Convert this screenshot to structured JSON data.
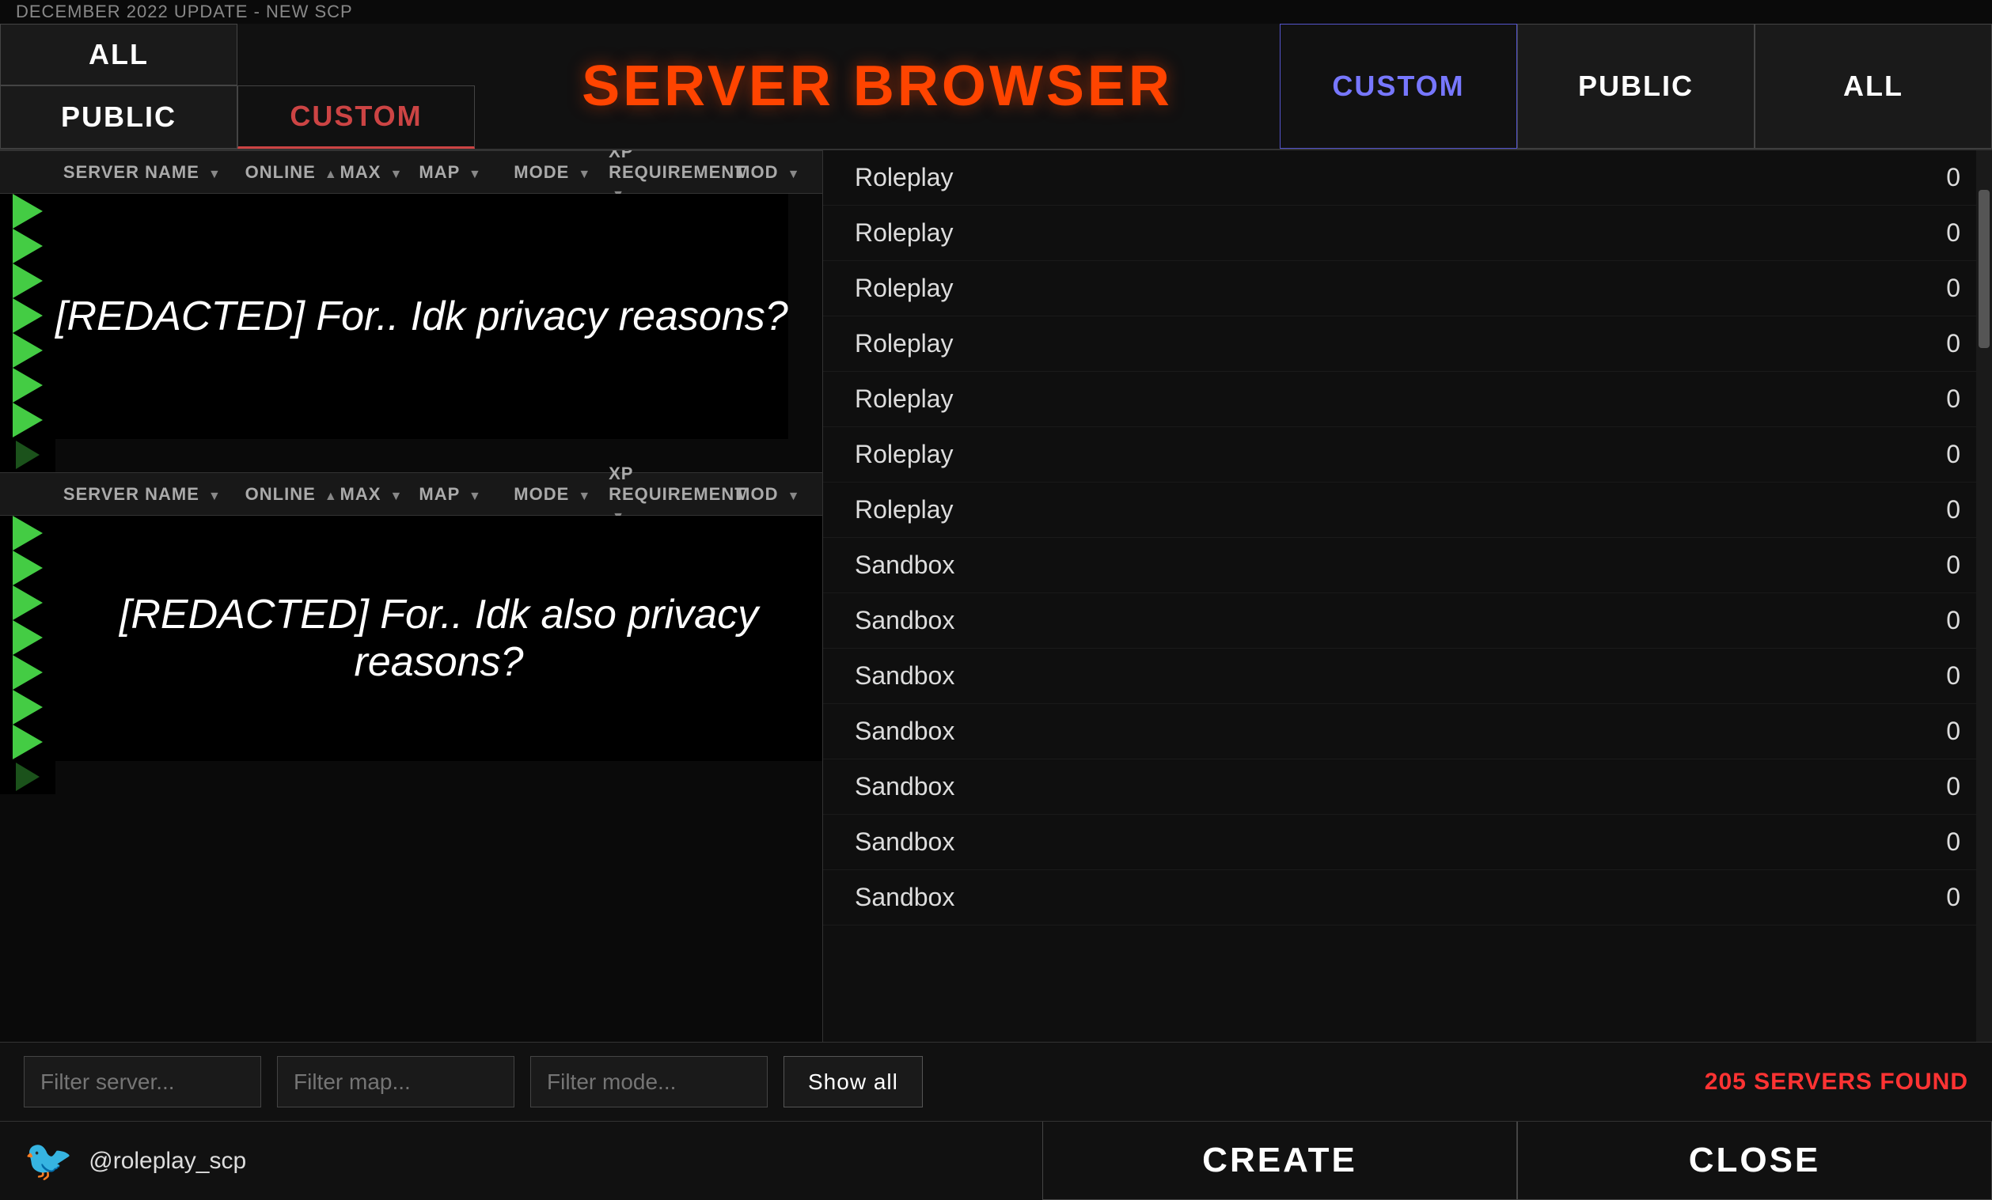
{
  "topBanner": {
    "text": "DECEMBER 2022 UPDATE - NEW SCP"
  },
  "nav": {
    "leftTabs": {
      "all": "ALL",
      "public": "PUBLIC",
      "custom": "CUSTOM"
    },
    "title": "SERVER BROWSER",
    "rightTabs": {
      "custom": "CUSTOM",
      "all": "ALL",
      "public": "PUBLIC"
    }
  },
  "tableHeaders": {
    "serverName": "SERVER NAME",
    "online": "ONLINE",
    "max": "MAX",
    "map": "MAP",
    "mode": "MODE",
    "xpRequirement": "XP REQUIREMENT",
    "mod": "MOD"
  },
  "section1": {
    "redactedText": "[REDACTED] For.. Idk privacy reasons?"
  },
  "section2": {
    "redactedText": "[REDACTED] For.. Idk also privacy reasons?"
  },
  "filterBar": {
    "filterServerPlaceholder": "Filter server...",
    "filterMapPlaceholder": "Filter map...",
    "filterModePlaceholder": "Filter mode...",
    "showAllLabel": "Show all",
    "serversFound": "205 SERVERS FOUND"
  },
  "actionBar": {
    "twitterHandle": "@roleplay_scp",
    "createLabel": "CREATE",
    "closeLabel": "CLOSE"
  },
  "rightPanel": {
    "rows": [
      {
        "mode": "Roleplay",
        "count": "0"
      },
      {
        "mode": "Roleplay",
        "count": "0"
      },
      {
        "mode": "Roleplay",
        "count": "0"
      },
      {
        "mode": "Roleplay",
        "count": "0"
      },
      {
        "mode": "Roleplay",
        "count": "0"
      },
      {
        "mode": "Roleplay",
        "count": "0"
      },
      {
        "mode": "Roleplay",
        "count": "0"
      },
      {
        "mode": "Sandbox",
        "count": "0"
      },
      {
        "mode": "Sandbox",
        "count": "0"
      },
      {
        "mode": "Sandbox",
        "count": "0"
      },
      {
        "mode": "Sandbox",
        "count": "0"
      },
      {
        "mode": "Sandbox",
        "count": "0"
      },
      {
        "mode": "Sandbox",
        "count": "0"
      },
      {
        "mode": "Sandbox",
        "count": "0"
      }
    ]
  },
  "playButtons": {
    "section1Count": 8,
    "section2Count": 8
  }
}
